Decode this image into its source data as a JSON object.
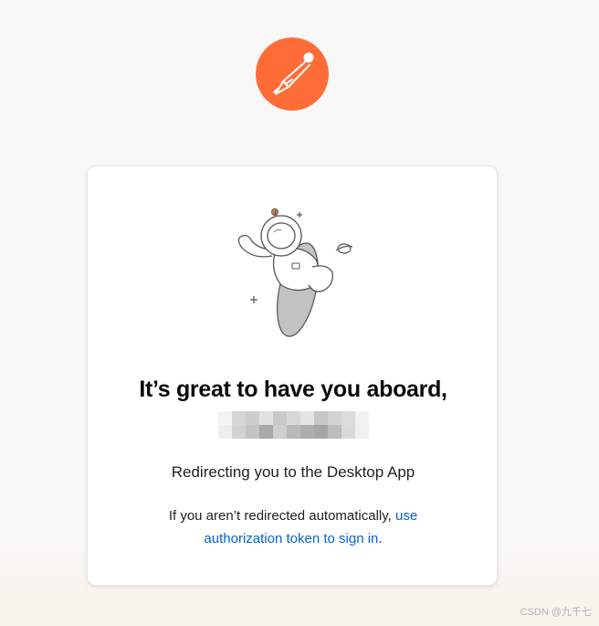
{
  "brand": {
    "logo_icon": "postman-rocket-icon",
    "accent_color": "#ff6c37"
  },
  "card": {
    "illustration_icon": "astronaut-illustration",
    "headline": "It’s great to have you aboard,",
    "redirect_text": "Redirecting you to the Desktop App",
    "fallback_prefix": "If you aren’t redirected automatically, ",
    "fallback_link": "use authorization token to sign in",
    "fallback_suffix": ".",
    "link_color": "#0265d2"
  },
  "watermark": "CSDN @九千七"
}
